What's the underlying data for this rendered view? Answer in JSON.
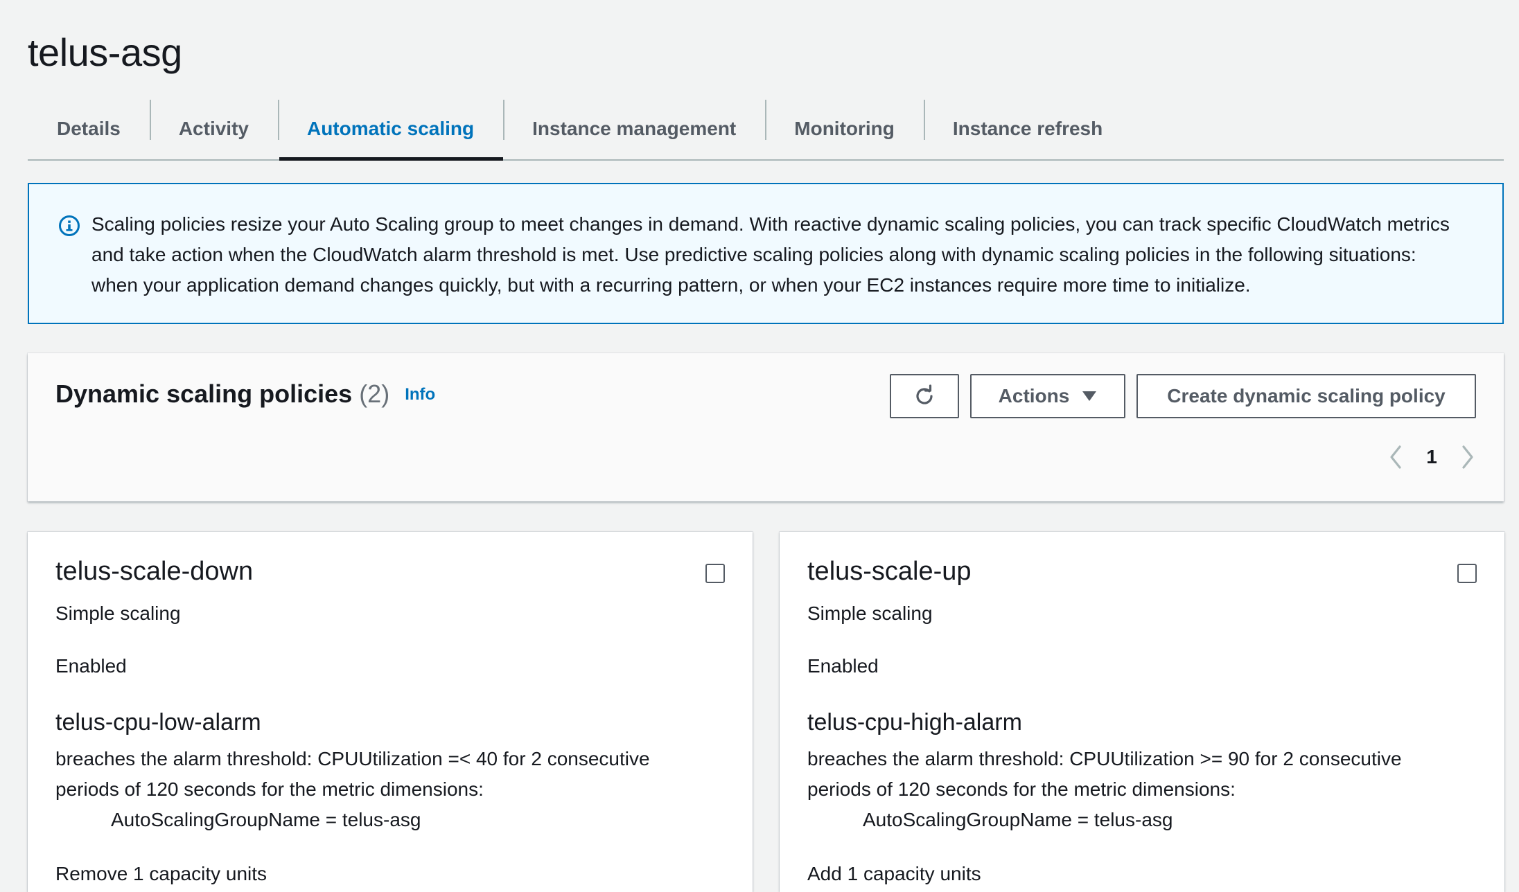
{
  "page": {
    "title": "telus-asg"
  },
  "tabs": [
    {
      "label": "Details",
      "active": false
    },
    {
      "label": "Activity",
      "active": false
    },
    {
      "label": "Automatic scaling",
      "active": true
    },
    {
      "label": "Instance management",
      "active": false
    },
    {
      "label": "Monitoring",
      "active": false
    },
    {
      "label": "Instance refresh",
      "active": false
    }
  ],
  "info_alert": {
    "icon": "info-circle-icon",
    "line1": "Scaling policies resize your Auto Scaling group to meet changes in demand. With reactive dynamic scaling policies, you can track specific CloudWatch metrics",
    "line2": "and take action when the CloudWatch alarm threshold is met. Use predictive scaling policies along with dynamic scaling policies in the following situations:",
    "line3": "when your application demand changes quickly, but with a recurring pattern, or when your EC2 instances require more time to initialize."
  },
  "policies_panel": {
    "title": "Dynamic scaling policies",
    "count": "(2)",
    "info_link": "Info",
    "refresh_icon": "refresh-icon",
    "actions_label": "Actions",
    "create_label": "Create dynamic scaling policy",
    "pagination": {
      "current_page": "1"
    }
  },
  "policies": [
    {
      "name": "telus-scale-down",
      "type": "Simple scaling",
      "status": "Enabled",
      "alarm_name": "telus-cpu-low-alarm",
      "alarm_desc_line1": "breaches the alarm threshold: CPUUtilization =< 40 for 2 consecutive",
      "alarm_desc_line2": "periods of 120 seconds for the metric dimensions:",
      "dimension": "AutoScalingGroupName = telus-asg",
      "action": "Remove 1 capacity units",
      "checked": false
    },
    {
      "name": "telus-scale-up",
      "type": "Simple scaling",
      "status": "Enabled",
      "alarm_name": "telus-cpu-high-alarm",
      "alarm_desc_line1": "breaches the alarm threshold: CPUUtilization >= 90 for 2 consecutive",
      "alarm_desc_line2": "periods of 120 seconds for the metric dimensions:",
      "dimension": "AutoScalingGroupName = telus-asg",
      "action": "Add 1 capacity units",
      "checked": false
    }
  ],
  "colors": {
    "accent": "#0073bb",
    "background": "#f2f3f3",
    "text": "#16191f",
    "muted": "#545b64",
    "info_bg": "#f1faff"
  }
}
